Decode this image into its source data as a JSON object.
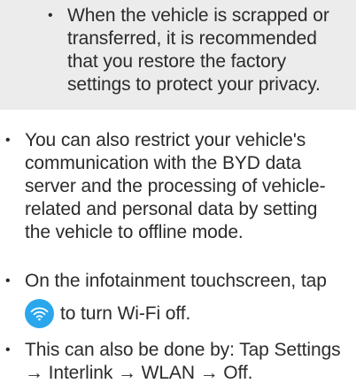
{
  "note": {
    "bullet": "•",
    "text": "When the vehicle is scrapped or\ntransferred, it is recommended\nthat you restore the factory\nsettings to protect your privacy."
  },
  "items": [
    {
      "bullet": "•",
      "text": "You can also restrict your vehicle's\ncommunication with the BYD data\nserver and the processing of vehicle-\nrelated and personal data by setting\nthe vehicle to offline mode."
    },
    {
      "bullet": "•",
      "text_before_icon": "On the infotainment touchscreen, tap",
      "icon": "wifi-icon",
      "text_after_icon": "to turn Wi-Fi off."
    },
    {
      "bullet": "•",
      "text": "This can also be done by: Tap Settings\n→ Interlink → WLAN → Off."
    }
  ],
  "colors": {
    "note_background": "#ececec",
    "icon_background": "#2aa7ec",
    "text": "#2b2b2b"
  }
}
